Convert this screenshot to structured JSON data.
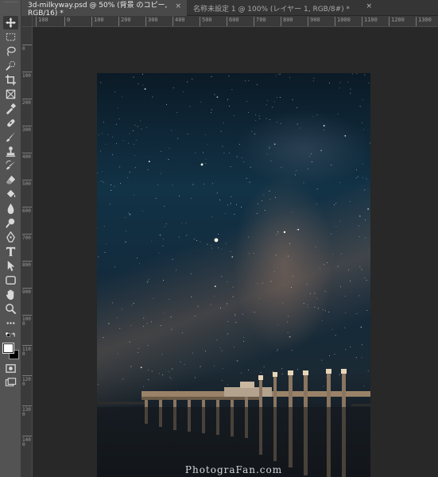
{
  "tabs": [
    {
      "label": "3d-milkyway.psd @ 50% (背景 のコピー, RGB/16) *",
      "close": "×",
      "active": true
    },
    {
      "label": "名称未設定 1 @ 100% (レイヤー 1, RGB/8#) *",
      "close": "×",
      "active": false
    }
  ],
  "ruler": {
    "horizontal": [
      "100",
      "0",
      "100",
      "200",
      "300",
      "400",
      "500",
      "600",
      "700",
      "800",
      "900",
      "1000",
      "1100",
      "1200",
      "1300",
      "1390"
    ],
    "vertical": [
      "0",
      "100",
      "200",
      "300",
      "400",
      "500",
      "600",
      "700",
      "800",
      "900",
      "1000",
      "1100",
      "1200",
      "1300",
      "1400",
      "1500"
    ]
  },
  "tools": [
    "move-tool",
    "marquee-tool",
    "lasso-tool",
    "quick-selection-tool",
    "crop-tool",
    "frame-tool",
    "eyedropper-tool",
    "healing-brush-tool",
    "brush-tool",
    "clone-stamp-tool",
    "history-brush-tool",
    "eraser-tool",
    "gradient-tool",
    "blur-tool",
    "dodge-tool",
    "pen-tool",
    "type-tool",
    "path-selection-tool",
    "rectangle-tool",
    "hand-tool",
    "zoom-tool",
    "edit-toolbar",
    "swap-colors",
    "color-swatches",
    "quick-mask-mode",
    "screen-mode"
  ],
  "colors": {
    "foreground": "#ffffff",
    "background": "#000000"
  },
  "image": {
    "watermark": "PhotograFan.com"
  }
}
